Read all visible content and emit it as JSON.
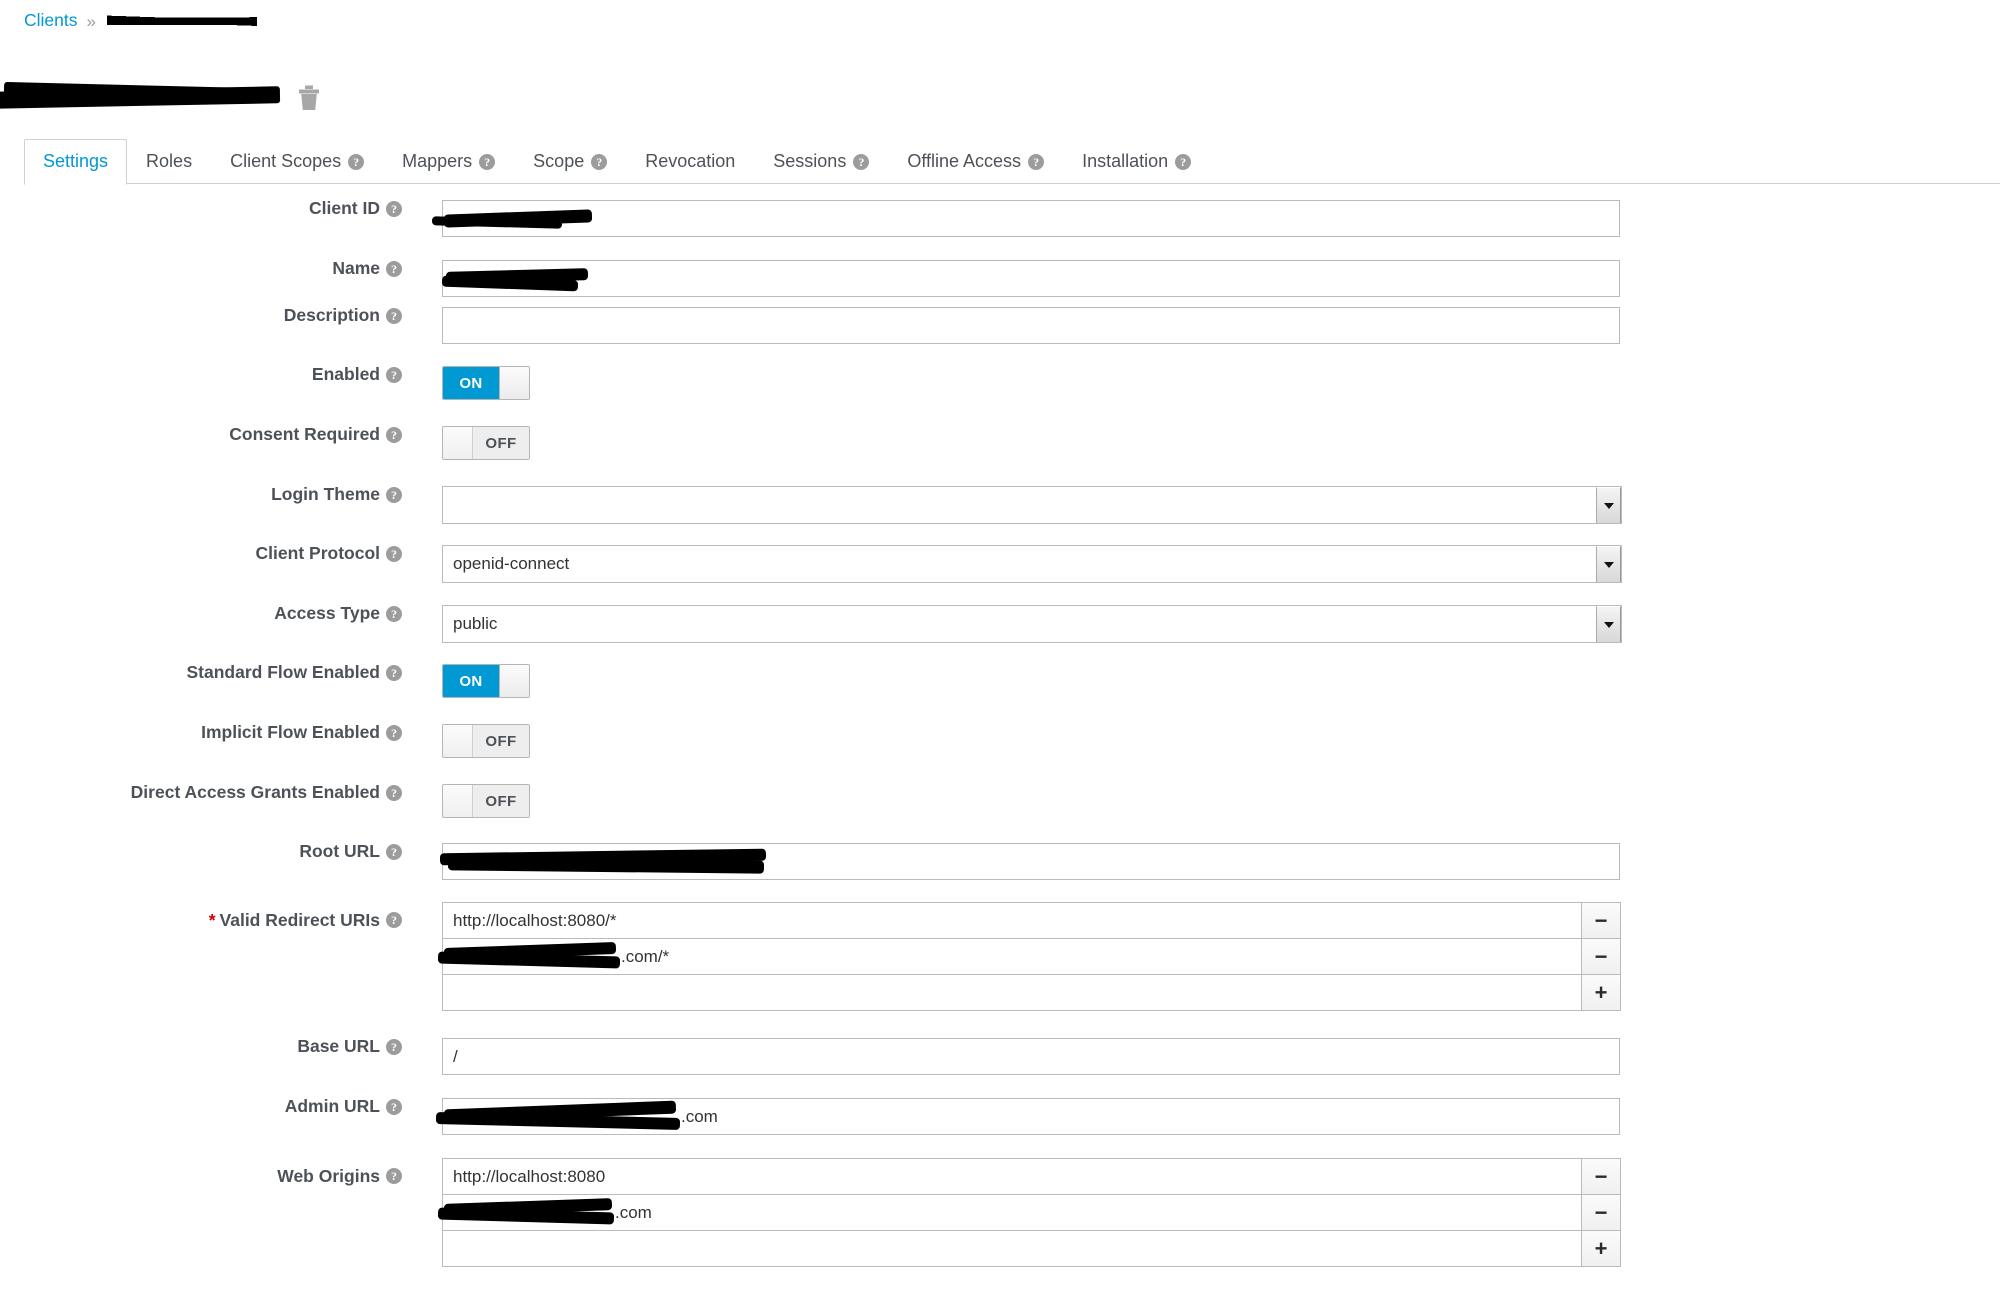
{
  "breadcrumb": {
    "root_label": "Clients",
    "separator": "»",
    "current_label": "[redacted]"
  },
  "header": {
    "title": "[redacted client name]",
    "delete_icon": "trash-icon"
  },
  "tabs": [
    {
      "label": "Settings",
      "help": false,
      "active": true
    },
    {
      "label": "Roles",
      "help": false,
      "active": false
    },
    {
      "label": "Client Scopes",
      "help": true,
      "active": false
    },
    {
      "label": "Mappers",
      "help": true,
      "active": false
    },
    {
      "label": "Scope",
      "help": true,
      "active": false
    },
    {
      "label": "Revocation",
      "help": false,
      "active": false
    },
    {
      "label": "Sessions",
      "help": true,
      "active": false
    },
    {
      "label": "Offline Access",
      "help": true,
      "active": false
    },
    {
      "label": "Installation",
      "help": true,
      "active": false
    }
  ],
  "form": {
    "client_id": {
      "label": "Client ID",
      "value": "",
      "redacted": true
    },
    "name": {
      "label": "Name",
      "value": "",
      "redacted": true
    },
    "description": {
      "label": "Description",
      "value": "",
      "placeholder": ""
    },
    "enabled": {
      "label": "Enabled",
      "state": "ON"
    },
    "consent_required": {
      "label": "Consent Required",
      "state": "OFF"
    },
    "login_theme": {
      "label": "Login Theme",
      "value": ""
    },
    "client_protocol": {
      "label": "Client Protocol",
      "value": "openid-connect"
    },
    "access_type": {
      "label": "Access Type",
      "value": "public"
    },
    "standard_flow_enabled": {
      "label": "Standard Flow Enabled",
      "state": "ON"
    },
    "implicit_flow_enabled": {
      "label": "Implicit Flow Enabled",
      "state": "OFF"
    },
    "direct_access_grants_enabled": {
      "label": "Direct Access Grants Enabled",
      "state": "OFF"
    },
    "root_url": {
      "label": "Root URL",
      "value": "",
      "redacted": true
    },
    "valid_redirect_uris": {
      "label": "Valid Redirect URIs",
      "required_marker": "*",
      "rows": [
        {
          "value": "http://localhost:8080/*",
          "button": "−",
          "redacted": false
        },
        {
          "value": ".com/*",
          "button": "−",
          "redacted": true
        },
        {
          "value": "",
          "button": "+",
          "redacted": false
        }
      ]
    },
    "base_url": {
      "label": "Base URL",
      "value": "/"
    },
    "admin_url": {
      "label": "Admin URL",
      "value": ".com",
      "redacted": true
    },
    "web_origins": {
      "label": "Web Origins",
      "rows": [
        {
          "value": "http://localhost:8080",
          "button": "−",
          "redacted": false
        },
        {
          "value": ".com",
          "button": "−",
          "redacted": true
        },
        {
          "value": "",
          "button": "+",
          "redacted": false
        }
      ]
    }
  },
  "colors": {
    "link": "#0099d3",
    "toggle_on": "#0099d3",
    "required": "#cc0000",
    "label": "#4d5258",
    "border": "#bbbbbb"
  }
}
